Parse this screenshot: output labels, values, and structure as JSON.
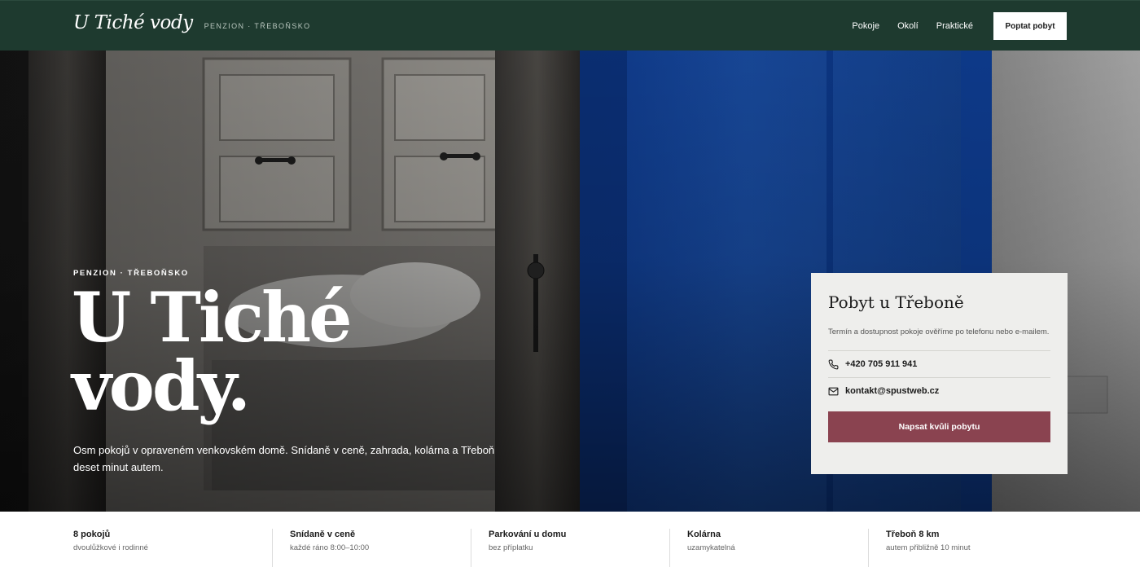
{
  "header": {
    "brand_name": "U Tiché vody",
    "brand_tag": "PENZION · TŘEBOŇSKO",
    "nav": [
      {
        "label": "Pokoje"
      },
      {
        "label": "Okolí"
      },
      {
        "label": "Praktické"
      }
    ],
    "cta_label": "Poptat pobyt"
  },
  "hero": {
    "eyebrow": "PENZION · TŘEBOŇSKO",
    "title_line1": "U Tiché",
    "title_line2": "vody.",
    "text": "Osm pokojů v opraveném venkovském domě. Snídaně v ceně, zahrada, kolárna a Třeboň deset minut autem."
  },
  "booking": {
    "title": "Pobyt u Třeboně",
    "text": "Termín a dostupnost pokoje ověříme po telefonu nebo e-mailem.",
    "phone": "+420 705 911 941",
    "email": "kontakt@spustweb.cz",
    "button_label": "Napsat kvůli pobytu",
    "accent_color": "#8a4350"
  },
  "facts": [
    {
      "title": "8 pokojů",
      "sub": "dvoulůžkové i rodinné"
    },
    {
      "title": "Snídaně v ceně",
      "sub": "každé ráno 8:00–10:00"
    },
    {
      "title": "Parkování u domu",
      "sub": "bez příplatku"
    },
    {
      "title": "Kolárna",
      "sub": "uzamykatelná"
    },
    {
      "title": "Třeboň 8 km",
      "sub": "autem přibližně 10 minut"
    }
  ],
  "colors": {
    "header_bg": "#1e3a2f",
    "door_blue": "#1a4fa8"
  }
}
